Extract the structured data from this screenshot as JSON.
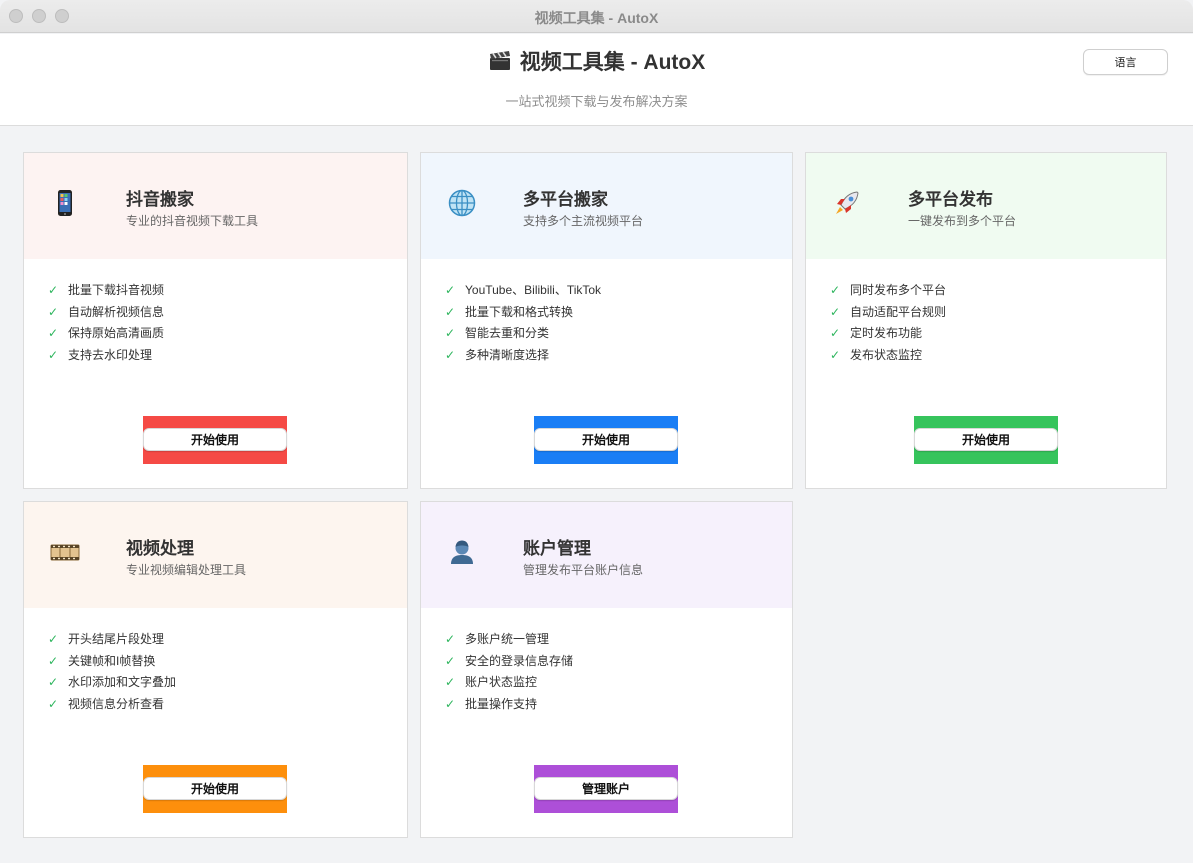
{
  "window": {
    "title": "视频工具集 - AutoX"
  },
  "header": {
    "title": "视频工具集 - AutoX",
    "subtitle": "一站式视频下载与发布解决方案",
    "language_button": "语言"
  },
  "cards": [
    {
      "title": "抖音搬家",
      "desc": "专业的抖音视频下载工具",
      "icon": "phone-icon",
      "features": [
        "批量下载抖音视频",
        "自动解析视频信息",
        "保持原始高清画质",
        "支持去水印处理"
      ],
      "button": "开始使用",
      "accent": "#f54a45",
      "head_bg": "#fdf3f2"
    },
    {
      "title": "多平台搬家",
      "desc": "支持多个主流视频平台",
      "icon": "globe-icon",
      "features": [
        "YouTube、Bilibili、TikTok",
        "批量下载和格式转换",
        "智能去重和分类",
        "多种清晰度选择"
      ],
      "button": "开始使用",
      "accent": "#1a7ef5",
      "head_bg": "#f0f6fd"
    },
    {
      "title": "多平台发布",
      "desc": "一键发布到多个平台",
      "icon": "rocket-icon",
      "features": [
        "同时发布多个平台",
        "自动适配平台规则",
        "定时发布功能",
        "发布状态监控"
      ],
      "button": "开始使用",
      "accent": "#36c45c",
      "head_bg": "#f0fbf1"
    },
    {
      "title": "视频处理",
      "desc": "专业视频编辑处理工具",
      "icon": "film-icon",
      "features": [
        "开头结尾片段处理",
        "关键帧和I帧替换",
        "水印添加和文字叠加",
        "视频信息分析查看"
      ],
      "button": "开始使用",
      "accent": "#fd8f0c",
      "head_bg": "#fdf5ef"
    },
    {
      "title": "账户管理",
      "desc": "管理发布平台账户信息",
      "icon": "user-icon",
      "features": [
        "多账户统一管理",
        "安全的登录信息存储",
        "账户状态监控",
        "批量操作支持"
      ],
      "button": "管理账户",
      "accent": "#ad4fd8",
      "head_bg": "#f6f1fc"
    }
  ]
}
